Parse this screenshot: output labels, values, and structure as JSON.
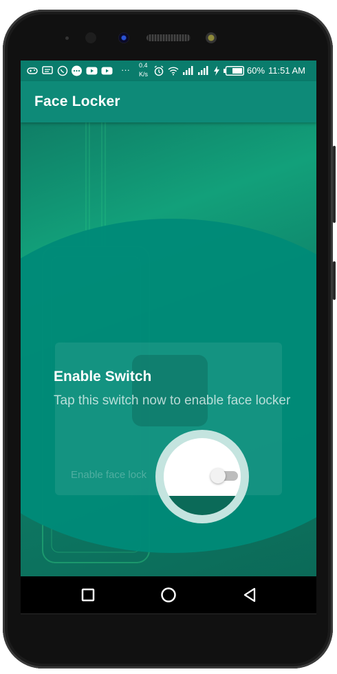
{
  "status_bar": {
    "net_speed_value": "0.4",
    "net_speed_unit": "K/s",
    "battery": "60%",
    "time": "11:51 AM",
    "more_dots": "···"
  },
  "app_bar": {
    "title": "Face Locker"
  },
  "tutorial": {
    "title": "Enable Switch",
    "description": "Tap this switch now to enable face locker"
  },
  "background_card": {
    "label": "Enable face lock"
  },
  "switch": {
    "state": "off"
  },
  "colors": {
    "app_bar": "#0e8a78",
    "status_bar": "#0a7c6c",
    "spotlight": "#008a78",
    "ring": "#c4e4df"
  },
  "nav_icons": [
    "recent-apps-icon",
    "home-icon",
    "back-icon"
  ]
}
